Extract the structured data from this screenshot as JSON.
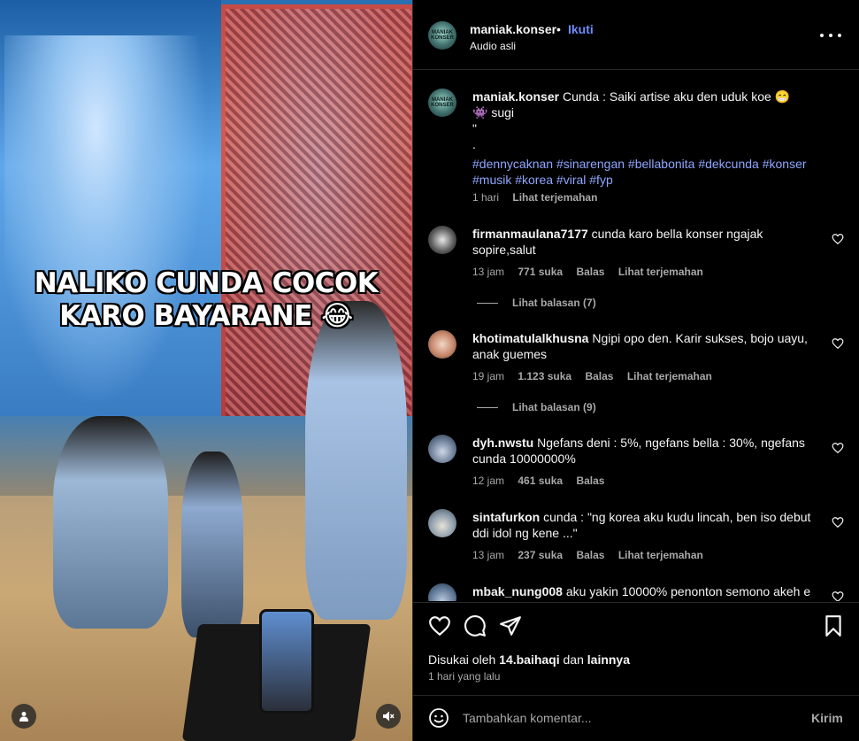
{
  "media": {
    "caption_line1": "NALIKO CUNDA COCOK",
    "caption_line2": "KARO BAYARANE",
    "caption_emoji": "😂",
    "user_icon": "person-icon",
    "audio_icon": "speaker-muted-icon"
  },
  "header": {
    "avatar_text": "MANIAK KONSER",
    "username": "maniak.konser",
    "separator": "•",
    "follow_label": "Ikuti",
    "audio_label": "Audio asli",
    "more_icon": "more-horizontal-icon"
  },
  "caption_post": {
    "username": "maniak.konser",
    "text": "Cunda : Saiki artise aku den uduk koe 😁",
    "line2": "👾 sugi",
    "line3": "\"",
    "line4": ".",
    "hashtags_line1": "#dennycaknan #sinarengan #bellabonita #dekcunda #konser",
    "hashtags_line2": "#musik #korea #viral #fyp",
    "time": "1 hari",
    "translate": "Lihat terjemahan"
  },
  "comments": [
    {
      "username": "firmanmaulana7177",
      "text": "cunda karo bella konser ngajak sopire,salut",
      "time": "13 jam",
      "likes": "771 suka",
      "reply": "Balas",
      "translate": "Lihat terjemahan",
      "view_replies": "Lihat balasan (7)"
    },
    {
      "username": "khotimatulalkhusna",
      "text": "Ngipi opo den. Karir sukses, bojo uayu, anak guemes",
      "time": "19 jam",
      "likes": "1.123 suka",
      "reply": "Balas",
      "translate": "Lihat terjemahan",
      "view_replies": "Lihat balasan (9)"
    },
    {
      "username": "dyh.nwstu",
      "text": "Ngefans deni : 5%, ngefans bella : 30%, ngefans cunda 10000000%",
      "time": "12 jam",
      "likes": "461 suka",
      "reply": "Balas"
    },
    {
      "username": "sintafurkon",
      "text": "cunda : \"ng korea aku kudu lincah, ben iso debut ddi idol ng kene ...\"",
      "time": "13 jam",
      "likes": "237 suka",
      "reply": "Balas",
      "translate": "Lihat terjemahan"
    },
    {
      "username": "mbak_nung008",
      "text": "aku yakin 10000% penonton semono akeh e"
    }
  ],
  "actions": {
    "like_icon": "heart-icon",
    "comment_icon": "comment-icon",
    "share_icon": "send-icon",
    "save_icon": "bookmark-icon",
    "liked_by_prefix": "Disukai oleh",
    "liked_by_user": "14.baihaqi",
    "liked_by_mid": "dan",
    "liked_by_others": "lainnya",
    "time_ago": "1 hari yang lalu"
  },
  "composer": {
    "emoji_icon": "smiley-icon",
    "placeholder": "Tambahkan komentar...",
    "send_label": "Kirim"
  },
  "colors": {
    "link_blue": "#6f8cff",
    "hashtag_blue": "#8fa6ff",
    "secondary_text": "#a8a8a8",
    "background": "#000000"
  }
}
